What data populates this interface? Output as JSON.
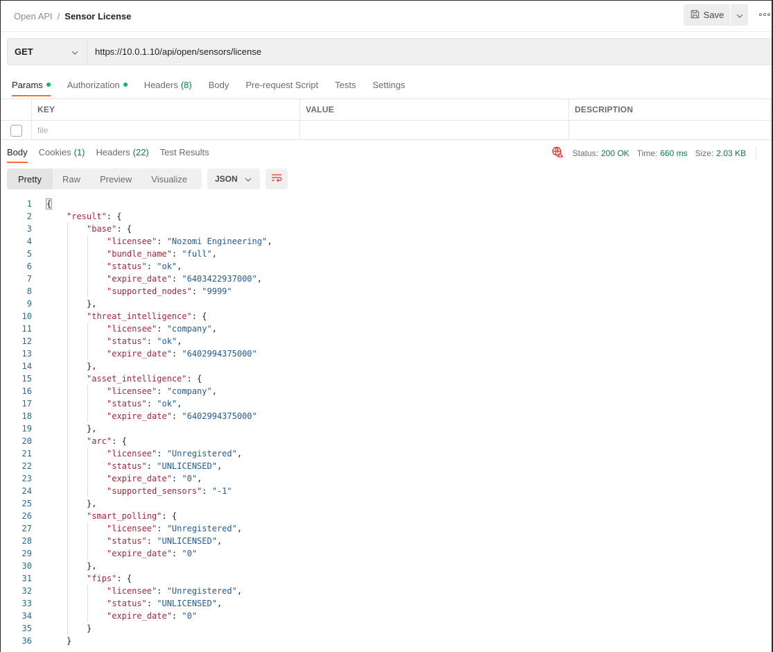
{
  "header": {
    "breadcrumb_parent": "Open API",
    "breadcrumb_separator": "/",
    "breadcrumb_current": "Sensor License",
    "save_label": "Save",
    "icons": {
      "save": "floppy-disk-icon",
      "caret": "chevron-down-icon",
      "more": "more-horizontal-icon"
    }
  },
  "request": {
    "method": "GET",
    "url": "https://10.0.1.10/api/open/sensors/license",
    "tabs": [
      {
        "label": "Params",
        "dot": true,
        "active": true
      },
      {
        "label": "Authorization",
        "dot": true
      },
      {
        "label": "Headers",
        "count": "(8)"
      },
      {
        "label": "Body"
      },
      {
        "label": "Pre-request Script"
      },
      {
        "label": "Tests"
      },
      {
        "label": "Settings"
      }
    ]
  },
  "params_table": {
    "columns": [
      "KEY",
      "VALUE",
      "DESCRIPTION"
    ],
    "rows": [
      {
        "checked": false,
        "key_placeholder": "file",
        "value": "",
        "description": ""
      }
    ]
  },
  "response": {
    "tabs": [
      {
        "label": "Body",
        "active": true
      },
      {
        "label": "Cookies",
        "count": "(1)"
      },
      {
        "label": "Headers",
        "count": "(22)"
      },
      {
        "label": "Test Results"
      }
    ],
    "status_label": "Status:",
    "status_value": "200 OK",
    "time_label": "Time:",
    "time_value": "660 ms",
    "size_label": "Size:",
    "size_value": "2.03 KB",
    "network_icon": "globe-warning-icon",
    "view_modes": [
      "Pretty",
      "Raw",
      "Preview",
      "Visualize"
    ],
    "active_view": "Pretty",
    "format": "JSON",
    "wrap_icon": "wrap-lines-icon"
  },
  "colors": {
    "accent": "#ff6c37",
    "success": "#0b7a3e",
    "dot": "#0cbb52",
    "json_key": "#a2283a",
    "json_string": "#1f5a97",
    "line_number": "#2b6a8a"
  },
  "code_lines": [
    {
      "n": "1",
      "indent": 0,
      "parts": [
        [
          "p",
          "{"
        ]
      ]
    },
    {
      "n": "2",
      "indent": 1,
      "parts": [
        [
          "k",
          "\"result\""
        ],
        [
          "p",
          ": {"
        ]
      ]
    },
    {
      "n": "3",
      "indent": 2,
      "parts": [
        [
          "k",
          "\"base\""
        ],
        [
          "p",
          ": {"
        ]
      ]
    },
    {
      "n": "4",
      "indent": 3,
      "parts": [
        [
          "k",
          "\"licensee\""
        ],
        [
          "p",
          ": "
        ],
        [
          "s",
          "\"Nozomi Engineering\""
        ],
        [
          "p",
          ","
        ]
      ]
    },
    {
      "n": "5",
      "indent": 3,
      "parts": [
        [
          "k",
          "\"bundle_name\""
        ],
        [
          "p",
          ": "
        ],
        [
          "s",
          "\"full\""
        ],
        [
          "p",
          ","
        ]
      ]
    },
    {
      "n": "6",
      "indent": 3,
      "parts": [
        [
          "k",
          "\"status\""
        ],
        [
          "p",
          ": "
        ],
        [
          "s",
          "\"ok\""
        ],
        [
          "p",
          ","
        ]
      ]
    },
    {
      "n": "7",
      "indent": 3,
      "parts": [
        [
          "k",
          "\"expire_date\""
        ],
        [
          "p",
          ": "
        ],
        [
          "s",
          "\"6403422937000\""
        ],
        [
          "p",
          ","
        ]
      ]
    },
    {
      "n": "8",
      "indent": 3,
      "parts": [
        [
          "k",
          "\"supported_nodes\""
        ],
        [
          "p",
          ": "
        ],
        [
          "s",
          "\"9999\""
        ]
      ]
    },
    {
      "n": "9",
      "indent": 2,
      "parts": [
        [
          "p",
          "},"
        ]
      ]
    },
    {
      "n": "10",
      "indent": 2,
      "parts": [
        [
          "k",
          "\"threat_intelligence\""
        ],
        [
          "p",
          ": {"
        ]
      ]
    },
    {
      "n": "11",
      "indent": 3,
      "parts": [
        [
          "k",
          "\"licensee\""
        ],
        [
          "p",
          ": "
        ],
        [
          "s",
          "\"company\""
        ],
        [
          "p",
          ","
        ]
      ]
    },
    {
      "n": "12",
      "indent": 3,
      "parts": [
        [
          "k",
          "\"status\""
        ],
        [
          "p",
          ": "
        ],
        [
          "s",
          "\"ok\""
        ],
        [
          "p",
          ","
        ]
      ]
    },
    {
      "n": "13",
      "indent": 3,
      "parts": [
        [
          "k",
          "\"expire_date\""
        ],
        [
          "p",
          ": "
        ],
        [
          "s",
          "\"6402994375000\""
        ]
      ]
    },
    {
      "n": "14",
      "indent": 2,
      "parts": [
        [
          "p",
          "},"
        ]
      ]
    },
    {
      "n": "15",
      "indent": 2,
      "parts": [
        [
          "k",
          "\"asset_intelligence\""
        ],
        [
          "p",
          ": {"
        ]
      ]
    },
    {
      "n": "16",
      "indent": 3,
      "parts": [
        [
          "k",
          "\"licensee\""
        ],
        [
          "p",
          ": "
        ],
        [
          "s",
          "\"company\""
        ],
        [
          "p",
          ","
        ]
      ]
    },
    {
      "n": "17",
      "indent": 3,
      "parts": [
        [
          "k",
          "\"status\""
        ],
        [
          "p",
          ": "
        ],
        [
          "s",
          "\"ok\""
        ],
        [
          "p",
          ","
        ]
      ]
    },
    {
      "n": "18",
      "indent": 3,
      "parts": [
        [
          "k",
          "\"expire_date\""
        ],
        [
          "p",
          ": "
        ],
        [
          "s",
          "\"6402994375000\""
        ]
      ]
    },
    {
      "n": "19",
      "indent": 2,
      "parts": [
        [
          "p",
          "},"
        ]
      ]
    },
    {
      "n": "20",
      "indent": 2,
      "parts": [
        [
          "k",
          "\"arc\""
        ],
        [
          "p",
          ": {"
        ]
      ]
    },
    {
      "n": "21",
      "indent": 3,
      "parts": [
        [
          "k",
          "\"licensee\""
        ],
        [
          "p",
          ": "
        ],
        [
          "s",
          "\"Unregistered\""
        ],
        [
          "p",
          ","
        ]
      ]
    },
    {
      "n": "22",
      "indent": 3,
      "parts": [
        [
          "k",
          "\"status\""
        ],
        [
          "p",
          ": "
        ],
        [
          "s",
          "\"UNLICENSED\""
        ],
        [
          "p",
          ","
        ]
      ]
    },
    {
      "n": "23",
      "indent": 3,
      "parts": [
        [
          "k",
          "\"expire_date\""
        ],
        [
          "p",
          ": "
        ],
        [
          "s",
          "\"0\""
        ],
        [
          "p",
          ","
        ]
      ]
    },
    {
      "n": "24",
      "indent": 3,
      "parts": [
        [
          "k",
          "\"supported_sensors\""
        ],
        [
          "p",
          ": "
        ],
        [
          "s",
          "\"-1\""
        ]
      ]
    },
    {
      "n": "25",
      "indent": 2,
      "parts": [
        [
          "p",
          "},"
        ]
      ]
    },
    {
      "n": "26",
      "indent": 2,
      "parts": [
        [
          "k",
          "\"smart_polling\""
        ],
        [
          "p",
          ": {"
        ]
      ]
    },
    {
      "n": "27",
      "indent": 3,
      "parts": [
        [
          "k",
          "\"licensee\""
        ],
        [
          "p",
          ": "
        ],
        [
          "s",
          "\"Unregistered\""
        ],
        [
          "p",
          ","
        ]
      ]
    },
    {
      "n": "28",
      "indent": 3,
      "parts": [
        [
          "k",
          "\"status\""
        ],
        [
          "p",
          ": "
        ],
        [
          "s",
          "\"UNLICENSED\""
        ],
        [
          "p",
          ","
        ]
      ]
    },
    {
      "n": "29",
      "indent": 3,
      "parts": [
        [
          "k",
          "\"expire_date\""
        ],
        [
          "p",
          ": "
        ],
        [
          "s",
          "\"0\""
        ]
      ]
    },
    {
      "n": "30",
      "indent": 2,
      "parts": [
        [
          "p",
          "},"
        ]
      ]
    },
    {
      "n": "31",
      "indent": 2,
      "parts": [
        [
          "k",
          "\"fips\""
        ],
        [
          "p",
          ": {"
        ]
      ]
    },
    {
      "n": "32",
      "indent": 3,
      "parts": [
        [
          "k",
          "\"licensee\""
        ],
        [
          "p",
          ": "
        ],
        [
          "s",
          "\"Unregistered\""
        ],
        [
          "p",
          ","
        ]
      ]
    },
    {
      "n": "33",
      "indent": 3,
      "parts": [
        [
          "k",
          "\"status\""
        ],
        [
          "p",
          ": "
        ],
        [
          "s",
          "\"UNLICENSED\""
        ],
        [
          "p",
          ","
        ]
      ]
    },
    {
      "n": "34",
      "indent": 3,
      "parts": [
        [
          "k",
          "\"expire_date\""
        ],
        [
          "p",
          ": "
        ],
        [
          "s",
          "\"0\""
        ]
      ]
    },
    {
      "n": "35",
      "indent": 2,
      "parts": [
        [
          "p",
          "}"
        ]
      ]
    },
    {
      "n": "36",
      "indent": 1,
      "parts": [
        [
          "p",
          "}"
        ]
      ]
    }
  ]
}
